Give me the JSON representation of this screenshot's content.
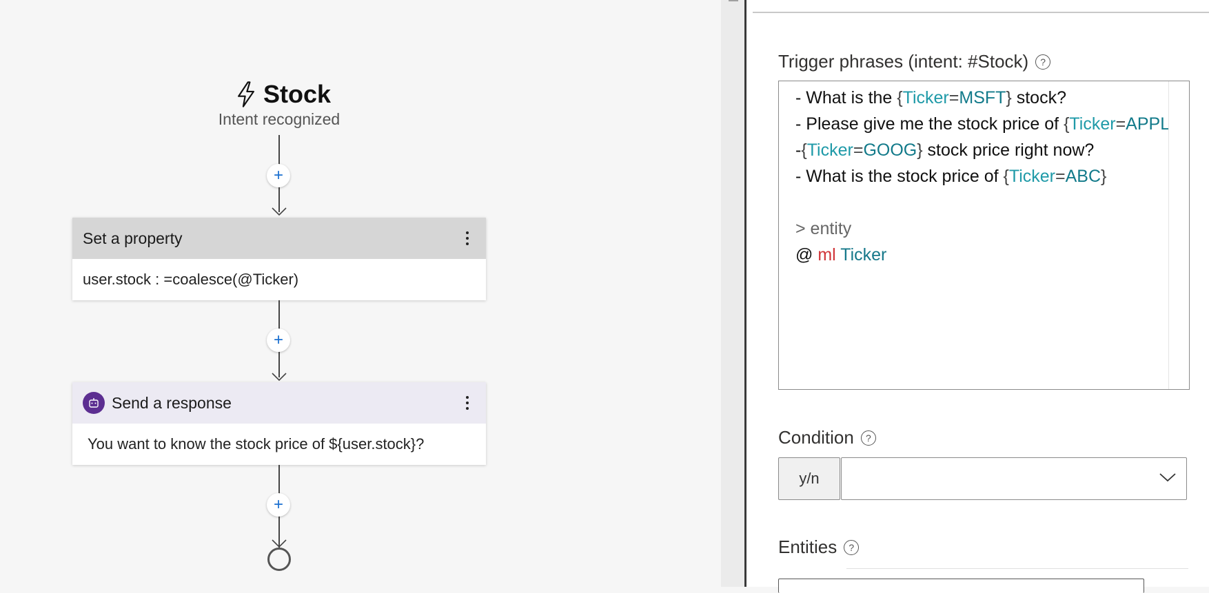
{
  "canvas": {
    "trigger": {
      "title": "Stock",
      "subtitle": "Intent recognized",
      "icon": "lightning-icon"
    },
    "add_button_label": "+",
    "nodes": [
      {
        "title": "Set a property",
        "body": "user.stock : =coalesce(@Ticker)",
        "header_color": "#d6d6d6"
      },
      {
        "title": "Send a response",
        "body": "You want to know the stock price of ${user.stock}?",
        "header_color": "#eceaf3",
        "icon": "bot-icon",
        "icon_color": "#5c2e91"
      }
    ]
  },
  "panel": {
    "trigger_phrases": {
      "label": "Trigger phrases (intent: #Stock)",
      "lines": [
        {
          "prefix": "- What is the ",
          "entity": "Ticker",
          "eq": "=",
          "value": "MSFT",
          "suffix": " stock?"
        },
        {
          "prefix": "- Please give me the stock price of ",
          "entity": "Ticker",
          "eq": "=",
          "value": "APPL",
          "suffix": "}"
        },
        {
          "prefix": "-",
          "entity": "Ticker",
          "eq": "=",
          "value": "GOOG",
          "suffix": " stock price right now?"
        },
        {
          "prefix": "- What is the stock price of ",
          "entity": "Ticker",
          "eq": "=",
          "value": "ABC",
          "suffix": ""
        }
      ],
      "entity_comment": "> entity",
      "entity_def": {
        "at": "@",
        "type": "ml",
        "name": "Ticker"
      }
    },
    "condition": {
      "label": "Condition",
      "prefix": "y/n",
      "value": ""
    },
    "entities": {
      "label": "Entities"
    }
  },
  "colors": {
    "entity": "#1f9aa8",
    "keyword_ml": "#d13438",
    "bot_purple": "#5c2e91",
    "add_plus": "#1a6fd0"
  }
}
